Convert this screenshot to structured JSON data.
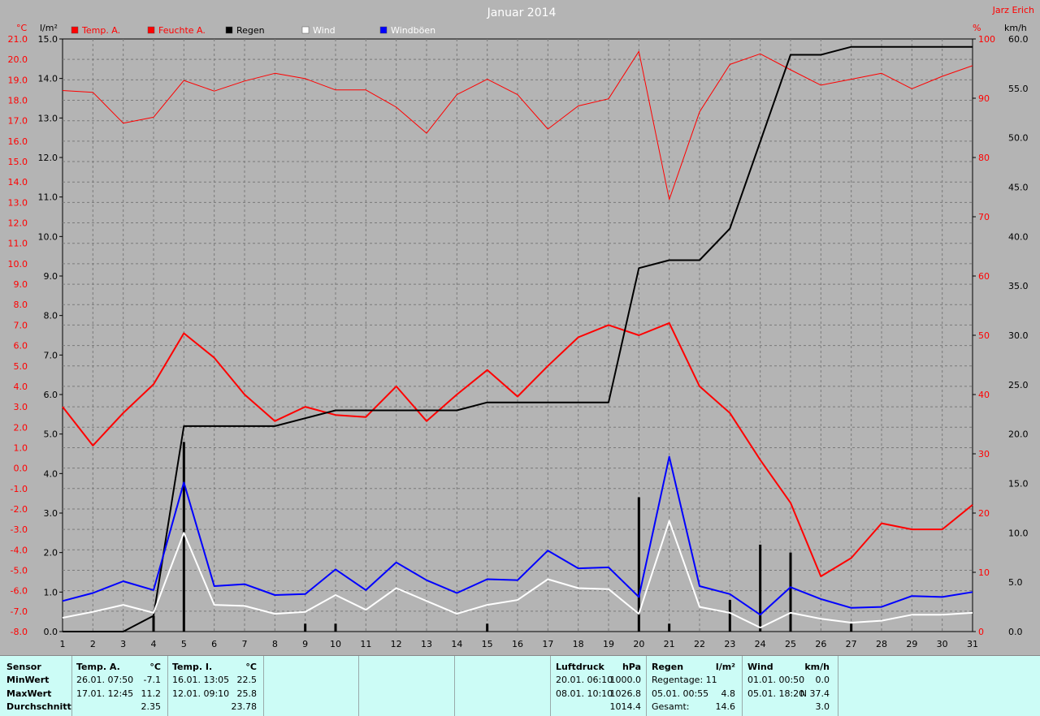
{
  "title": "Januar 2014",
  "corner_label": "Jarz Erich",
  "axes": {
    "temp_unit": "°C",
    "rain_unit": "l/m²",
    "humidity_unit": "%",
    "wind_unit": "km/h"
  },
  "legend": [
    {
      "label": "Temp. A.",
      "color": "#ff0000",
      "text_color": "#ff0000"
    },
    {
      "label": "Feuchte A.",
      "color": "#ff0000",
      "text_color": "#ff0000"
    },
    {
      "label": "Regen",
      "color": "#000000",
      "text_color": "#000000"
    },
    {
      "label": "Wind",
      "color": "#ffffff",
      "text_color": "#ffffff"
    },
    {
      "label": "Windböen",
      "color": "#0000ff",
      "text_color": "#ffffff"
    }
  ],
  "chart_data": {
    "type": "line",
    "x_label_values": [
      1,
      2,
      3,
      4,
      5,
      6,
      7,
      8,
      9,
      10,
      11,
      12,
      13,
      14,
      15,
      16,
      17,
      18,
      19,
      20,
      21,
      22,
      23,
      24,
      25,
      26,
      27,
      28,
      29,
      30,
      31
    ],
    "temp_axis": {
      "min": -8.0,
      "max": 21.0,
      "step": 1.0,
      "ticks": [
        "-8.0",
        "-7.0",
        "-6.0",
        "-5.0",
        "-4.0",
        "-3.0",
        "-2.0",
        "-1.0",
        "0.0",
        "1.0",
        "2.0",
        "3.0",
        "4.0",
        "5.0",
        "6.0",
        "7.0",
        "8.0",
        "9.0",
        "10.0",
        "11.0",
        "12.0",
        "13.0",
        "14.0",
        "15.0",
        "16.0",
        "17.0",
        "18.0",
        "19.0",
        "20.0",
        "21.0"
      ]
    },
    "rain_axis": {
      "min": 0.0,
      "max": 15.0,
      "step": 1.0,
      "ticks": [
        "0.0",
        "1.0",
        "2.0",
        "3.0",
        "4.0",
        "5.0",
        "6.0",
        "7.0",
        "8.0",
        "9.0",
        "10.0",
        "11.0",
        "12.0",
        "13.0",
        "14.0",
        "15.0"
      ]
    },
    "humidity_axis": {
      "min": 0,
      "max": 100,
      "step": 10,
      "ticks": [
        "0",
        "10",
        "20",
        "30",
        "40",
        "50",
        "60",
        "70",
        "80",
        "90",
        "100"
      ]
    },
    "wind_axis": {
      "min": 0.0,
      "max": 60.0,
      "step": 5.0,
      "ticks": [
        "0.0",
        "5.0",
        "10.0",
        "15.0",
        "20.0",
        "25.0",
        "30.0",
        "35.0",
        "40.0",
        "45.0",
        "50.0",
        "55.0",
        "60.0"
      ]
    },
    "series": [
      {
        "name": "Feuchte A.",
        "axis": "humidity",
        "color": "#ff0000",
        "width": 1,
        "values": [
          91.3,
          91.0,
          85.8,
          86.8,
          93.0,
          91.2,
          92.9,
          94.2,
          93.3,
          91.4,
          91.4,
          88.5,
          84.1,
          90.6,
          93.2,
          90.6,
          84.8,
          88.7,
          89.9,
          97.9,
          72.9,
          87.7,
          95.7,
          97.5,
          94.8,
          92.2,
          93.2,
          94.2,
          91.6,
          93.7,
          95.5
        ]
      },
      {
        "name": "Temp. A.",
        "axis": "temp",
        "color": "#ff0000",
        "width": 2,
        "values": [
          3.0,
          1.1,
          2.7,
          4.1,
          6.6,
          5.4,
          3.6,
          2.3,
          3.0,
          2.6,
          2.5,
          4.0,
          2.3,
          3.6,
          4.8,
          3.5,
          5.0,
          6.4,
          7.0,
          6.5,
          7.1,
          4.0,
          2.7,
          0.4,
          -1.7,
          -5.3,
          -4.4,
          -2.7,
          -3.0,
          -3.0,
          -1.8
        ]
      },
      {
        "name": "Regen",
        "axis": "rain",
        "color": "#000000",
        "width": 2,
        "values": [
          0.0,
          0.0,
          0.0,
          0.4,
          5.2,
          5.2,
          5.2,
          5.2,
          5.4,
          5.6,
          5.6,
          5.6,
          5.6,
          5.6,
          5.8,
          5.8,
          5.8,
          5.8,
          5.8,
          9.2,
          9.4,
          9.4,
          10.2,
          12.4,
          14.6,
          14.6,
          14.8,
          14.8,
          14.8,
          14.8,
          14.8
        ]
      },
      {
        "name": "Wind",
        "axis": "wind",
        "color": "#ffffff",
        "width": 2,
        "values": [
          1.4,
          2.0,
          2.7,
          1.9,
          10.0,
          2.7,
          2.6,
          1.8,
          2.0,
          3.7,
          2.2,
          4.4,
          3.1,
          1.8,
          2.7,
          3.2,
          5.3,
          4.4,
          4.3,
          1.8,
          11.2,
          2.5,
          1.9,
          0.4,
          1.9,
          1.3,
          0.9,
          1.1,
          1.7,
          1.7,
          1.9
        ]
      },
      {
        "name": "Windböen",
        "axis": "wind",
        "color": "#0000ff",
        "width": 2,
        "values": [
          3.1,
          3.9,
          5.1,
          4.2,
          15.1,
          4.6,
          4.8,
          3.7,
          3.8,
          6.3,
          4.2,
          7.0,
          5.2,
          3.9,
          5.3,
          5.2,
          8.2,
          6.4,
          6.5,
          3.5,
          17.7,
          4.6,
          3.8,
          1.7,
          4.5,
          3.3,
          2.4,
          2.5,
          3.6,
          3.5,
          4.0
        ]
      }
    ],
    "rain_bars": {
      "name": "Regen (Tag)",
      "axis": "rain",
      "color": "#000000",
      "values": [
        0,
        0,
        0,
        0.4,
        4.8,
        0,
        0,
        0,
        0.2,
        0.2,
        0,
        0,
        0,
        0,
        0.2,
        0,
        0,
        0,
        0,
        3.4,
        0.2,
        0,
        0.8,
        2.2,
        2.0,
        0,
        0.2,
        0,
        0,
        0,
        0
      ]
    }
  },
  "stats": {
    "sensor": {
      "h1": "Sensor",
      "min": "MinWert",
      "max": "MaxWert",
      "avg": "Durchschnitt"
    },
    "temp_a": {
      "h1": "Temp. A.",
      "unit": "°C",
      "min_time": "26.01.  07:50",
      "min_val": "-7.1",
      "max_time": "17.01.  12:45",
      "max_val": "11.2",
      "avg_val": "2.35"
    },
    "temp_i": {
      "h1": "Temp. I.",
      "unit": "°C",
      "min_time": "16.01.  13:05",
      "min_val": "22.5",
      "max_time": "12.01.  09:10",
      "max_val": "25.8",
      "avg_val": "23.78"
    },
    "luftdruck": {
      "h1": "Luftdruck",
      "unit": "hPa",
      "min_time": "20.01.  06:10",
      "min_val": "1000.0",
      "max_time": "08.01.  10:10",
      "max_val": "1026.8",
      "avg_val": "1014.4"
    },
    "regen": {
      "h1": "Regen",
      "unit": "l/m²",
      "r1_label": "Regentage: 11",
      "r1_val": "",
      "r2_label": "05.01.  00:55",
      "r2_val": "4.8",
      "r3_label": "Gesamt:",
      "r3_val": "14.6"
    },
    "wind": {
      "h1": "Wind",
      "unit": "km/h",
      "min_time": "01.01.  00:50",
      "min_val": "0.0",
      "max_time": "05.01.  18:20",
      "max_val": "N 37.4",
      "avg_val": "3.0"
    }
  }
}
